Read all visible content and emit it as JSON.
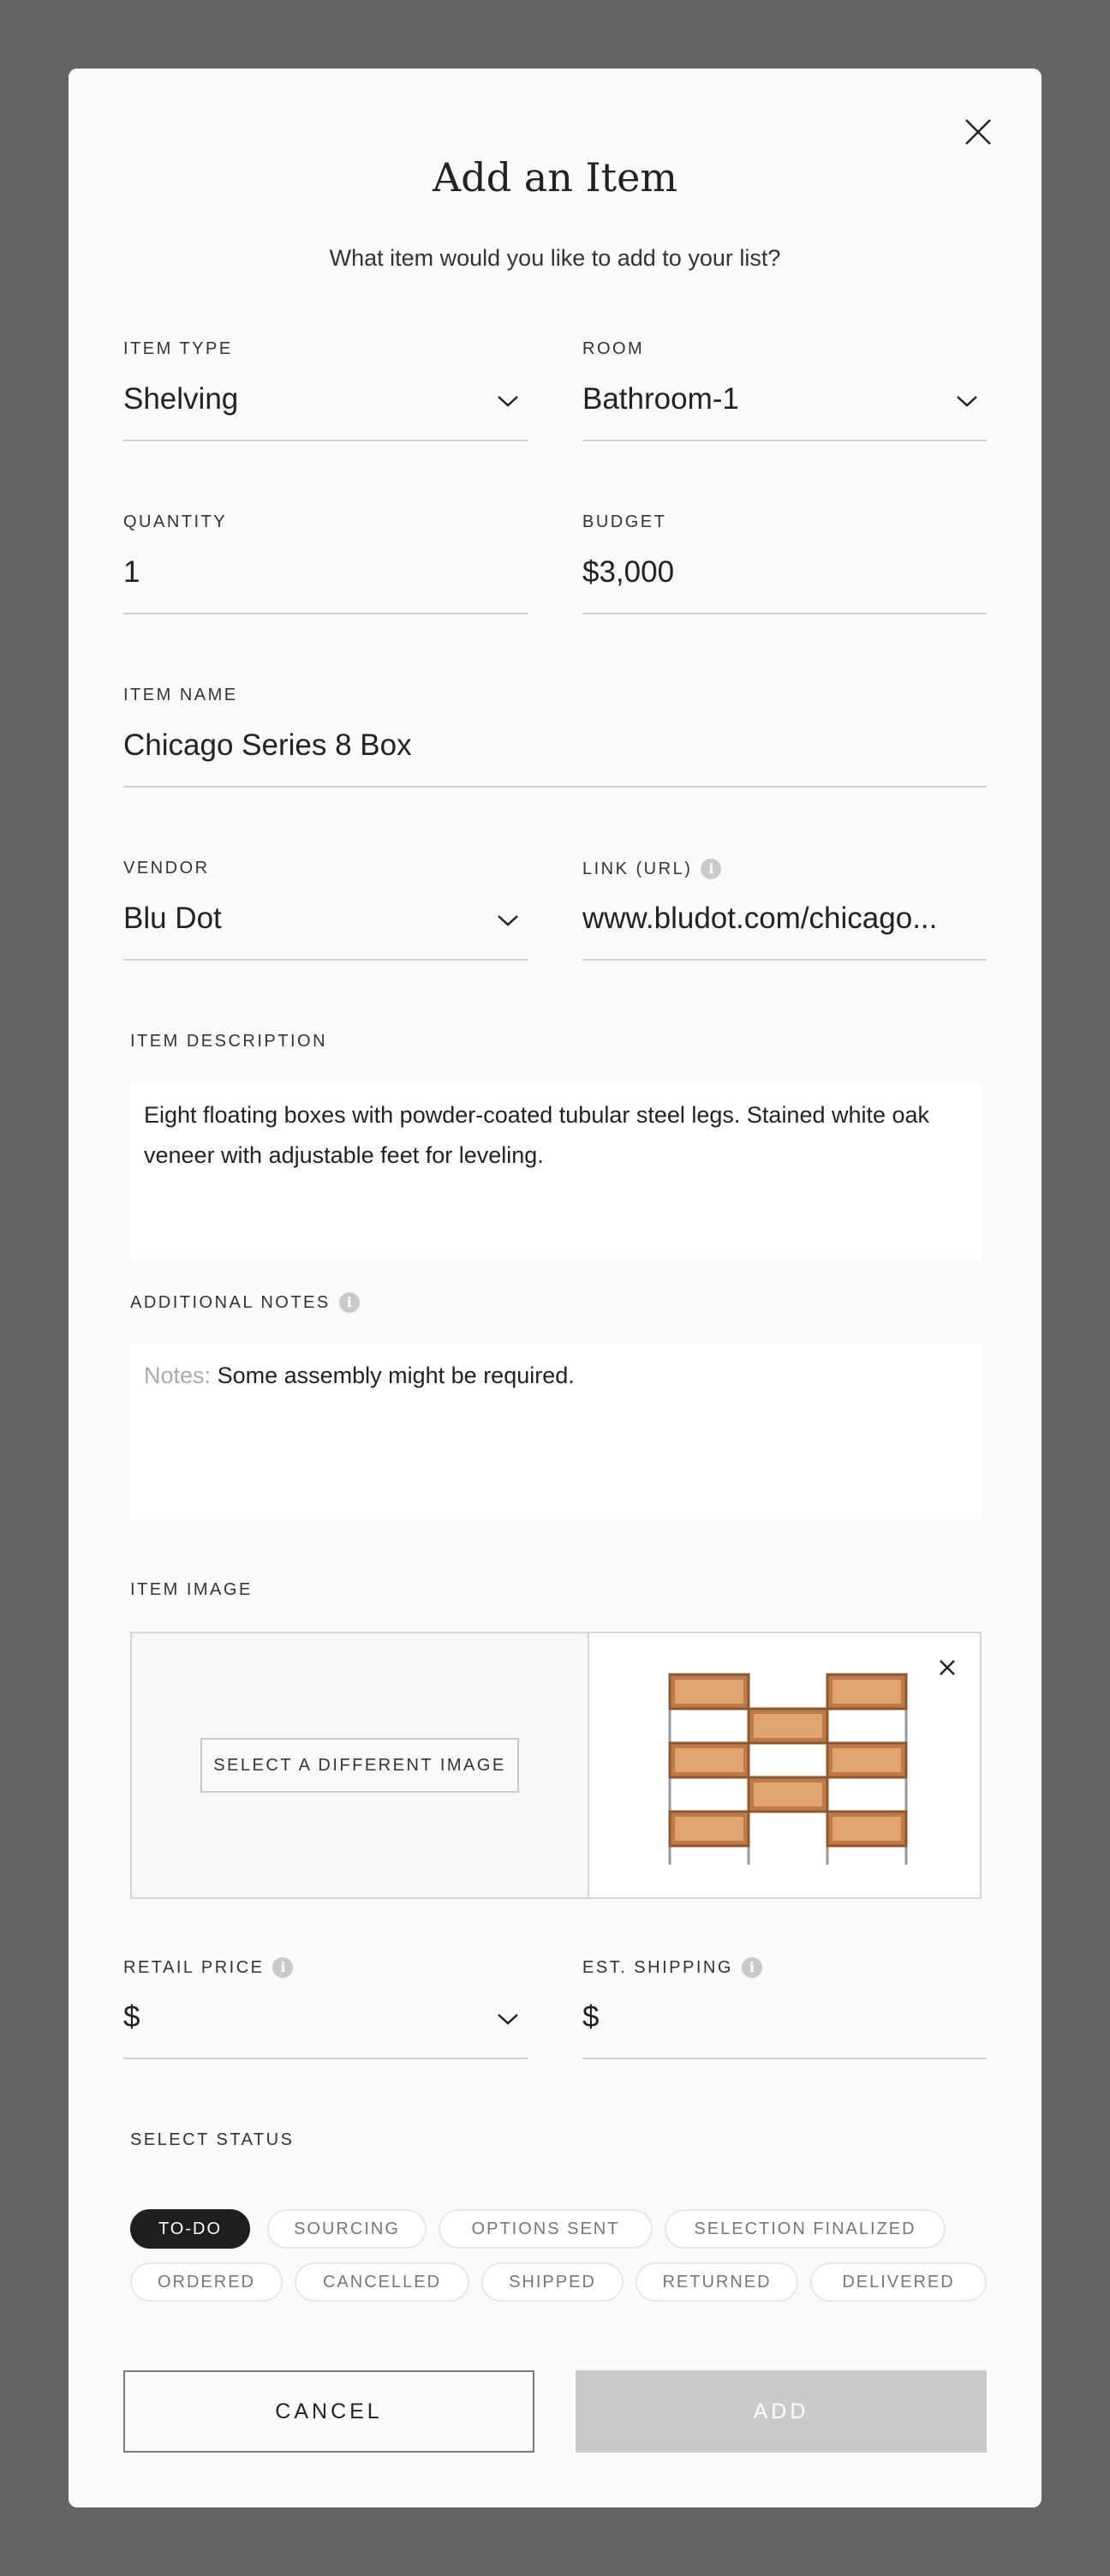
{
  "modal": {
    "title": "Add an Item",
    "subtitle": "What item would you like to add to your list?"
  },
  "fields": {
    "item_type": {
      "label": "ITEM TYPE",
      "value": "Shelving"
    },
    "room": {
      "label": "ROOM",
      "value": "Bathroom-1"
    },
    "quantity": {
      "label": "QUANTITY",
      "value": "1"
    },
    "budget": {
      "label": "BUDGET",
      "value": "$3,000"
    },
    "item_name": {
      "label": "ITEM NAME",
      "value": "Chicago Series 8 Box"
    },
    "vendor": {
      "label": "VENDOR",
      "value": "Blu Dot"
    },
    "link": {
      "label": "LINK (URL)",
      "value": "www.bludot.com/chicago..."
    },
    "description": {
      "label": "ITEM DESCRIPTION",
      "value": "Eight floating boxes with powder-coated tubular steel legs. Stained white oak veneer with adjustable feet for leveling."
    },
    "notes": {
      "label": "ADDITIONAL NOTES",
      "prefix": "Notes:",
      "value": "Some assembly might be required."
    },
    "image": {
      "label": "ITEM IMAGE",
      "select_button": "SELECT A DIFFERENT IMAGE"
    },
    "retail_price": {
      "label": "RETAIL PRICE",
      "value": "$"
    },
    "shipping": {
      "label": "EST. SHIPPING",
      "value": "$"
    }
  },
  "status": {
    "label": "SELECT STATUS",
    "options": [
      "TO-DO",
      "SOURCING",
      "OPTIONS SENT",
      "SELECTION FINALIZED",
      "ORDERED",
      "CANCELLED",
      "SHIPPED",
      "RETURNED",
      "DELIVERED"
    ],
    "selected": "TO-DO"
  },
  "buttons": {
    "cancel": "CANCEL",
    "add": "ADD"
  },
  "icons": {
    "close": "close-icon",
    "dropdown": "chevron-down-icon",
    "info": "info-icon",
    "remove_image": "close-icon"
  },
  "info_glyph": "i",
  "colors": {
    "overlay": "#646464",
    "modal_bg": "#fafafa",
    "active_pill": "#1e1e1e",
    "add_button_disabled": "#cacaca",
    "wood": "#b06a38"
  }
}
